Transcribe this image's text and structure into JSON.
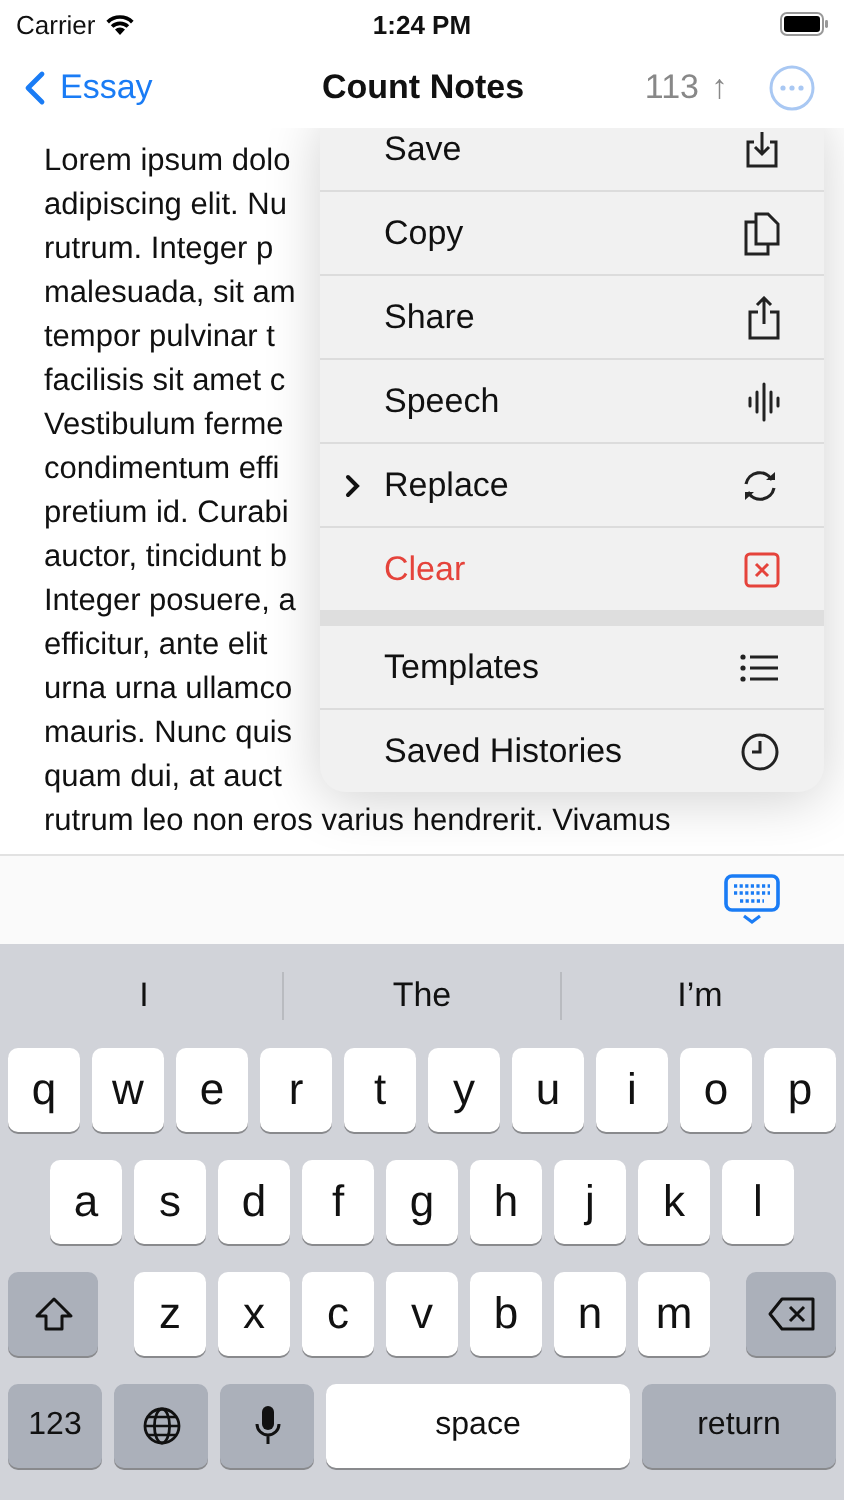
{
  "status_bar": {
    "carrier": "Carrier",
    "time": "1:24 PM"
  },
  "nav": {
    "back": "Essay",
    "title": "Count Notes",
    "count": "113",
    "count_arrow": "↑"
  },
  "text_lines": [
    "Lorem ipsum dolo",
    "adipiscing elit. Nu",
    "rutrum. Integer p",
    "malesuada, sit am",
    "tempor pulvinar t",
    "facilisis sit amet c",
    "Vestibulum ferme",
    "condimentum effi",
    "pretium id. Curabi",
    "auctor, tincidunt b",
    "Integer posuere, a",
    "efficitur, ante elit",
    "urna urna ullamco",
    "mauris. Nunc quis",
    "quam dui, at auct",
    "rutrum leo non eros varius hendrerit. Vivamus"
  ],
  "menu": {
    "groups": [
      [
        {
          "label": "Save",
          "submenu": false,
          "destructive": false
        },
        {
          "label": "Copy",
          "submenu": false,
          "destructive": false
        },
        {
          "label": "Share",
          "submenu": false,
          "destructive": false
        },
        {
          "label": "Speech",
          "submenu": false,
          "destructive": false
        },
        {
          "label": "Replace",
          "submenu": true,
          "destructive": false
        },
        {
          "label": "Clear",
          "submenu": false,
          "destructive": true
        }
      ],
      [
        {
          "label": "Templates",
          "submenu": false,
          "destructive": false
        },
        {
          "label": "Saved Histories",
          "submenu": false,
          "destructive": false
        }
      ]
    ]
  },
  "suggestions": [
    "I",
    "The",
    "I’m"
  ],
  "keyboard": {
    "rows": [
      [
        "q",
        "w",
        "e",
        "r",
        "t",
        "y",
        "u",
        "i",
        "o",
        "p"
      ],
      [
        "a",
        "s",
        "d",
        "f",
        "g",
        "h",
        "j",
        "k",
        "l"
      ],
      [
        "z",
        "x",
        "c",
        "v",
        "b",
        "n",
        "m"
      ]
    ],
    "numbers": "123",
    "space": "space",
    "return": "return"
  }
}
